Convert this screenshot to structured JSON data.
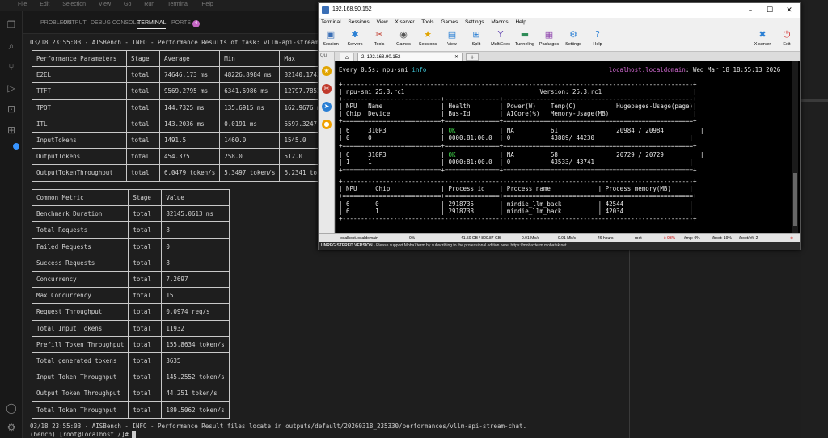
{
  "vscode": {
    "menu": [
      "File",
      "Edit",
      "Selection",
      "View",
      "Go",
      "Run",
      "Terminal",
      "Help"
    ],
    "panel_tabs": [
      "PROBLEMS",
      "OUTPUT",
      "DEBUG CONSOLE",
      "TERMINAL",
      "PORTS"
    ],
    "ports_count": "4"
  },
  "terminal": {
    "header_line": "03/18 23:55:03 - AISBench - INFO - Performance Results of task: vllm-api-stream-chat",
    "perf_table": {
      "headers": [
        "Performance Parameters",
        "Stage",
        "Average",
        "Min",
        "Max"
      ],
      "rows": [
        [
          "E2EL",
          "total",
          "74646.173 ms",
          "48226.8984 ms",
          "82140.1743"
        ],
        [
          "TTFT",
          "total",
          "9569.2795 ms",
          "6341.5986 ms",
          "12797.7852"
        ],
        [
          "TPOT",
          "total",
          "144.7325 ms",
          "135.6915 ms",
          "162.9676 m"
        ],
        [
          "ITL",
          "total",
          "143.2036 ms",
          "0.0191 ms",
          "6597.3247"
        ],
        [
          "InputTokens",
          "total",
          "1491.5",
          "1460.0",
          "1545.0"
        ],
        [
          "OutputTokens",
          "total",
          "454.375",
          "258.0",
          "512.0"
        ],
        [
          "OutputTokenThroughput",
          "total",
          "6.0479 token/s",
          "5.3497 token/s",
          "6.2341 tok"
        ]
      ]
    },
    "common_table": {
      "headers": [
        "Common Metric",
        "Stage",
        "Value"
      ],
      "rows": [
        [
          "Benchmark Duration",
          "total",
          "82145.0613 ms"
        ],
        [
          "Total Requests",
          "total",
          "8"
        ],
        [
          "Failed Requests",
          "total",
          "0"
        ],
        [
          "Success Requests",
          "total",
          "8"
        ],
        [
          "Concurrency",
          "total",
          "7.2697"
        ],
        [
          "Max Concurrency",
          "total",
          "15"
        ],
        [
          "Request Throughput",
          "total",
          "0.0974 req/s"
        ],
        [
          "Total Input Tokens",
          "total",
          "11932"
        ],
        [
          "Prefill Token Throughput",
          "total",
          "155.8634 token/s"
        ],
        [
          "Total generated tokens",
          "total",
          "3635"
        ],
        [
          "Input Token Throughput",
          "total",
          "145.2552 token/s"
        ],
        [
          "Output Token Throughput",
          "total",
          "44.251 token/s"
        ],
        [
          "Total Token Throughput",
          "total",
          "189.5062 token/s"
        ]
      ]
    },
    "footer_line": "03/18 23:55:03 - AISBench - INFO - Performance Result files locate in outputs/default/20260318_235330/performances/vllm-api-stream-chat.",
    "prompt": "(bench) [root@localhost /]# "
  },
  "moba": {
    "title": "192.168.90.152",
    "menu": [
      "Terminal",
      "Sessions",
      "View",
      "X server",
      "Tools",
      "Games",
      "Settings",
      "Macros",
      "Help"
    ],
    "toolbar": [
      {
        "label": "Session",
        "icon": "session-icon",
        "glyph": "▣",
        "color": "#3b6fb6"
      },
      {
        "label": "Servers",
        "icon": "servers-icon",
        "glyph": "✱",
        "color": "#2a7fd4"
      },
      {
        "label": "Tools",
        "icon": "tools-icon",
        "glyph": "✂",
        "color": "#c0392b"
      },
      {
        "label": "Games",
        "icon": "games-icon",
        "glyph": "◉",
        "color": "#555555"
      },
      {
        "label": "Sessions",
        "icon": "sessions-icon",
        "glyph": "★",
        "color": "#e1a400"
      },
      {
        "label": "View",
        "icon": "view-icon",
        "glyph": "▤",
        "color": "#2a7fd4"
      },
      {
        "label": "Split",
        "icon": "split-icon",
        "glyph": "⊞",
        "color": "#2a7fd4"
      },
      {
        "label": "MultiExec",
        "icon": "multiexec-icon",
        "glyph": "Y",
        "color": "#6a4fb5"
      },
      {
        "label": "Tunneling",
        "icon": "tunneling-icon",
        "glyph": "▬",
        "color": "#2e8b57"
      },
      {
        "label": "Packages",
        "icon": "packages-icon",
        "glyph": "▦",
        "color": "#8e44ad"
      },
      {
        "label": "Settings",
        "icon": "settings-icon",
        "glyph": "⚙",
        "color": "#2a7fd4"
      },
      {
        "label": "Help",
        "icon": "help-icon",
        "glyph": "?",
        "color": "#2a7fd4"
      }
    ],
    "toolbar_right": [
      {
        "label": "X server",
        "icon": "x-server-icon",
        "glyph": "✖",
        "color": "#2a7fd4"
      },
      {
        "label": "Exit",
        "icon": "exit-icon",
        "glyph": "⏻",
        "color": "#d32f2f"
      }
    ],
    "quick_connect": "Qu",
    "session_tab": "2. 192.168.90.152",
    "watch_left": "Every 0.5s: npu-smi ",
    "watch_cmd": "info",
    "watch_host": "localhost.localdomain",
    "watch_date": ": Wed Mar 18 18:55:13 2026",
    "smi": {
      "sep_plus": "+------------------------------------------------------------------------------------------------+",
      "sep_eq": "+===========================+===============+====================================================+",
      "sep_mid": "+---------------------------+---------------+----------------------------------------------------+",
      "version_line": "| npu-smi 25.3.rc1                                     Version: 25.3.rc1                         |",
      "hdr1": "| NPU   Name                | Health        | Power(W)    Temp(C)           Hugepages-Usage(page)|",
      "hdr2": "| Chip  Device              | Bus-Id        | AICore(%)   Memory-Usage(MB)                       |",
      "npu0_l1_a": "| 6     310P3               | ",
      "npu0_l1_ok": "OK",
      "npu0_l1_b": "            | NA          61                20984 / 20984          |",
      "npu0_l2": "| 0     0                   | 0000:81:00.0  | 0           43889/ 44230                          |",
      "npu1_l1_a": "| 6     310P3               | ",
      "npu1_l1_ok": "OK",
      "npu1_l1_b": "            | NA          58                20729 / 20729          |",
      "npu1_l2": "| 1     1                   | 0000:81:00.0  | 0           43533/ 43741                          |",
      "proc_hdr": "| NPU     Chip              | Process id    | Process name             | Process memory(MB)     |",
      "proc1": "| 6       0                 | 2918735       | mindie_llm_back          | 42544                  |",
      "proc2": "| 6       1                 | 2918738       | mindie_llm_back          | 42034                  |"
    },
    "status": {
      "host": "localhost.localdomain",
      "cpu": "0%",
      "disk": "41.50 GB / 800.87 GB",
      "up": "0.01 Mb/s",
      "down": "0.01 Mb/s",
      "uptime": "46 hours",
      "user": "root",
      "fs1": "/: 93%",
      "fs2": "/tmp: 0%",
      "fs3": "/boot: 19%",
      "fs4": "/boot/efi: 2"
    },
    "unregistered": "UNREGISTERED VERSION",
    "unregistered_msg": "  -  Please support MobaXterm by subscribing to the professional edition here:  https://mobaxterm.mobatek.net"
  }
}
